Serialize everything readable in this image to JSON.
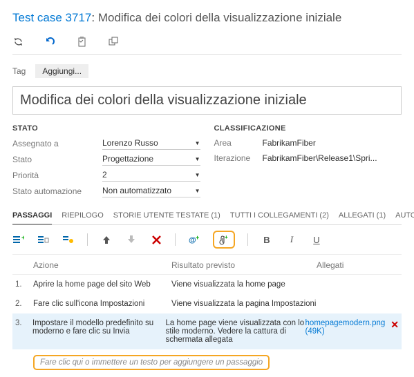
{
  "title": {
    "link": "Test case 3717",
    "sep": ":",
    "text": "Modifica dei colori della visualizzazione iniziale"
  },
  "tags": {
    "label": "Tag",
    "add": "Aggiungi..."
  },
  "bigTitle": "Modifica dei colori della visualizzazione iniziale",
  "stato": {
    "head": "STATO",
    "fields": {
      "assegnato": {
        "label": "Assegnato a",
        "value": "Lorenzo Russo"
      },
      "stato": {
        "label": "Stato",
        "value": "Progettazione"
      },
      "priorita": {
        "label": "Priorità",
        "value": "2"
      },
      "autom": {
        "label": "Stato automazione",
        "value": "Non automatizzato"
      }
    }
  },
  "classif": {
    "head": "CLASSIFICAZIONE",
    "fields": {
      "area": {
        "label": "Area",
        "value": "FabrikamFiber"
      },
      "iter": {
        "label": "Iterazione",
        "value": "FabrikamFiber\\Release1\\Spri..."
      }
    }
  },
  "tabs": {
    "passaggi": "PASSAGGI",
    "riepilogo": "RIEPILOGO",
    "storie": "STORIE UTENTE TESTATE (1)",
    "collegamenti": "TUTTI I COLLEGAMENTI (2)",
    "allegati": "ALLEGATI (1)",
    "automazione": "AUTOMAZIONE ASSOCIA..."
  },
  "fmt": {
    "bold": "B",
    "italic": "I",
    "underline": "U"
  },
  "stepsHeader": {
    "action": "Azione",
    "expected": "Risultato previsto",
    "attach": "Allegati"
  },
  "steps": {
    "s1": {
      "num": "1.",
      "action": "Aprire la home page del sito Web",
      "expected": "Viene visualizzata la home page"
    },
    "s2": {
      "num": "2.",
      "action": "Fare clic sull'icona Impostazioni",
      "expected": "Viene visualizzata la pagina Impostazioni"
    },
    "s3": {
      "num": "3.",
      "action": "Impostare il modello predefinito su moderno e fare clic su Invia",
      "expected": "La home page viene visualizzata con lo stile moderno. Vedere la cattura di schermata allegata",
      "attachName": "homepagemodern.png",
      "attachSize": "(49K)"
    }
  },
  "addStep": "Fare clic qui o immettere un testo per aggiungere un passaggio"
}
